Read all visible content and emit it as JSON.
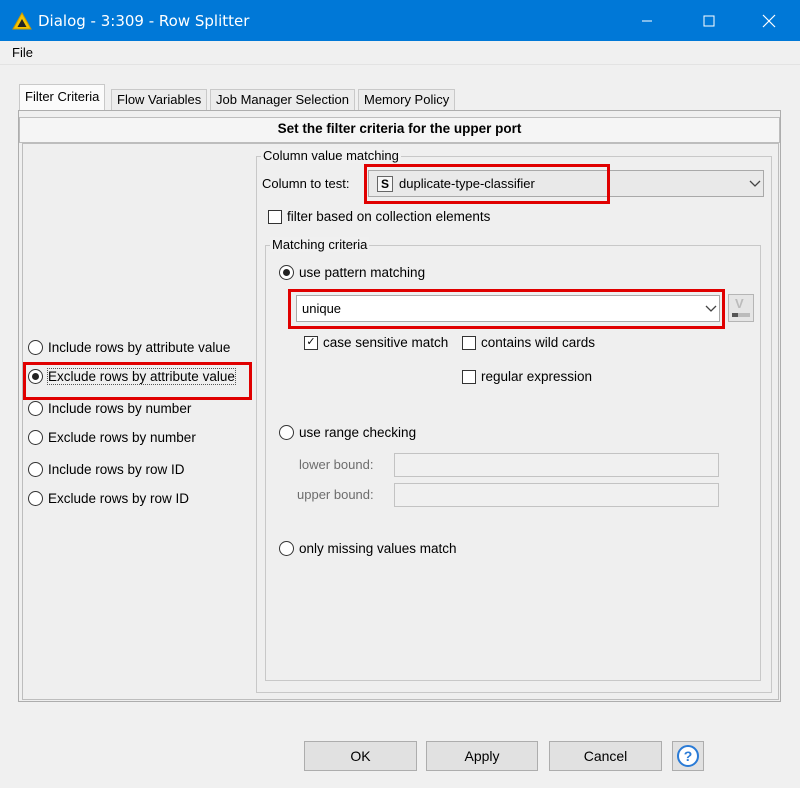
{
  "window": {
    "title": "Dialog - 3:309 - Row Splitter",
    "title_color": "#0078d7"
  },
  "menu": {
    "file": "File"
  },
  "tabs": [
    {
      "label": "Filter Criteria",
      "active": true
    },
    {
      "label": "Flow Variables",
      "active": false
    },
    {
      "label": "Job Manager Selection",
      "active": false
    },
    {
      "label": "Memory Policy",
      "active": false
    }
  ],
  "panel": {
    "header": "Set the filter criteria for the upper port"
  },
  "mode_options": [
    {
      "label": "Include rows by attribute value",
      "selected": false
    },
    {
      "label": "Exclude rows by attribute value",
      "selected": true
    },
    {
      "label": "Include rows by number",
      "selected": false
    },
    {
      "label": "Exclude rows by number",
      "selected": false
    },
    {
      "label": "Include rows by row ID",
      "selected": false
    },
    {
      "label": "Exclude rows by row ID",
      "selected": false
    }
  ],
  "column_matching": {
    "group_title": "Column value matching",
    "column_label": "Column to test:",
    "column_type_icon": "S",
    "column_value": "duplicate-type-classifier",
    "collection_label": "filter based on collection elements",
    "collection_checked": false
  },
  "matching_criteria": {
    "group_title": "Matching criteria",
    "pattern_label": "use pattern matching",
    "pattern_selected": true,
    "pattern_value": "unique",
    "variable_button_icon": "V",
    "case_sensitive_label": "case sensitive match",
    "case_sensitive_checked": true,
    "wildcards_label": "contains wild cards",
    "wildcards_checked": false,
    "regex_label": "regular expression",
    "regex_checked": false,
    "range_label": "use range checking",
    "range_selected": false,
    "lower_label": "lower bound:",
    "lower_value": "",
    "upper_label": "upper bound:",
    "upper_value": "",
    "missing_label": "only missing values match",
    "missing_selected": false
  },
  "buttons": {
    "ok": "OK",
    "apply": "Apply",
    "cancel": "Cancel",
    "help_icon": "?"
  },
  "highlight_color": "#e00000"
}
